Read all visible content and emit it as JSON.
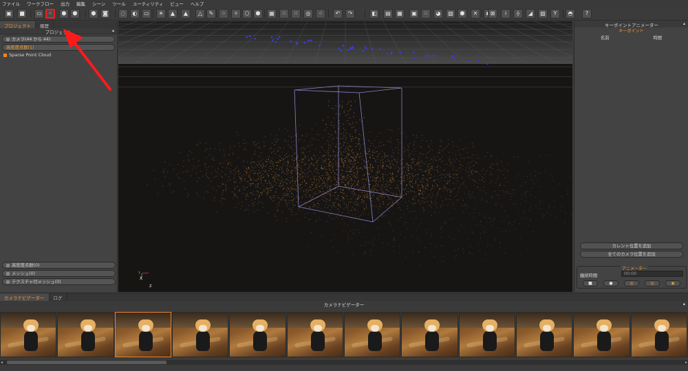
{
  "menu": [
    "ファイル",
    "ワークフロー",
    "出力",
    "編集",
    "シーン",
    "ツール",
    "ユーティリティ",
    "ビュー",
    "ヘルプ"
  ],
  "left": {
    "tabs": [
      "プロジェクト",
      "履歴"
    ],
    "header": "プロジェクト",
    "cameras": "カメラ(44 から 44)",
    "dense": "高密度点群(1)",
    "sparse": "Sparse Point Cloud",
    "bottom": [
      "高密度点群(0)",
      "メッシュ(0)",
      "テクスチャ付メッシュ(0)"
    ]
  },
  "right": {
    "header": "キーポイントアニメーター",
    "sub": "キーポイント",
    "col_name": "名前",
    "col_time": "時間",
    "add_current": "カレント位置を追加",
    "add_all": "全てのカメラ位置を追加",
    "animator_label": "アニメーター",
    "duration_label": "継続時間",
    "time_value": "00:00"
  },
  "bottom": {
    "tabs": [
      "カメラナビゲーター",
      "ログ"
    ],
    "title": "カメラナビゲーター",
    "thumb_count": 12,
    "selected_index": 2
  },
  "viewport": {
    "axis_y": "Y",
    "axis_x": "X",
    "axis_z": "Z"
  },
  "colors": {
    "accent": "#ff9a2a",
    "highlight": "#ff1a1a",
    "points": "#e89a3c",
    "box": "#8a84c8"
  }
}
